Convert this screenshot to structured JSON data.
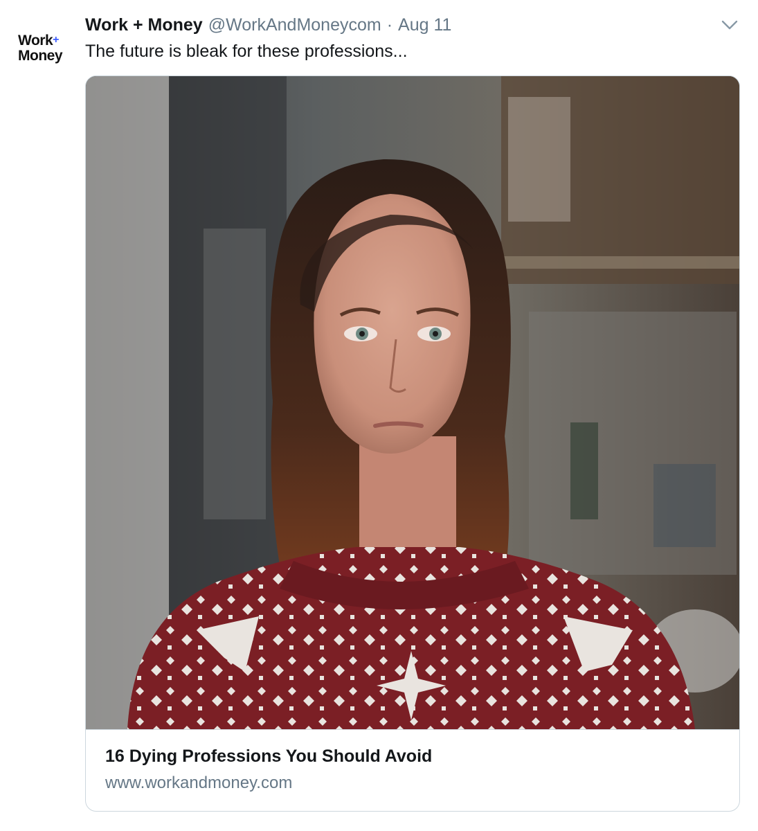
{
  "tweet": {
    "avatar": {
      "line1": "Work",
      "plus": "+",
      "line2": "Money"
    },
    "author_name": "Work + Money",
    "handle": "@WorkAndMoneycom",
    "separator": "·",
    "date": "Aug 11",
    "text": "The future is bleak for these professions...",
    "menu_icon": "chevron-down-icon"
  },
  "card": {
    "image_subject": "photo",
    "title": "16 Dying Professions You Should Avoid",
    "domain": "www.workandmoney.com"
  },
  "colors": {
    "text_primary": "#14171a",
    "text_secondary": "#657786",
    "border": "#ccd6dd",
    "brand_plus": "#3b5bff"
  }
}
